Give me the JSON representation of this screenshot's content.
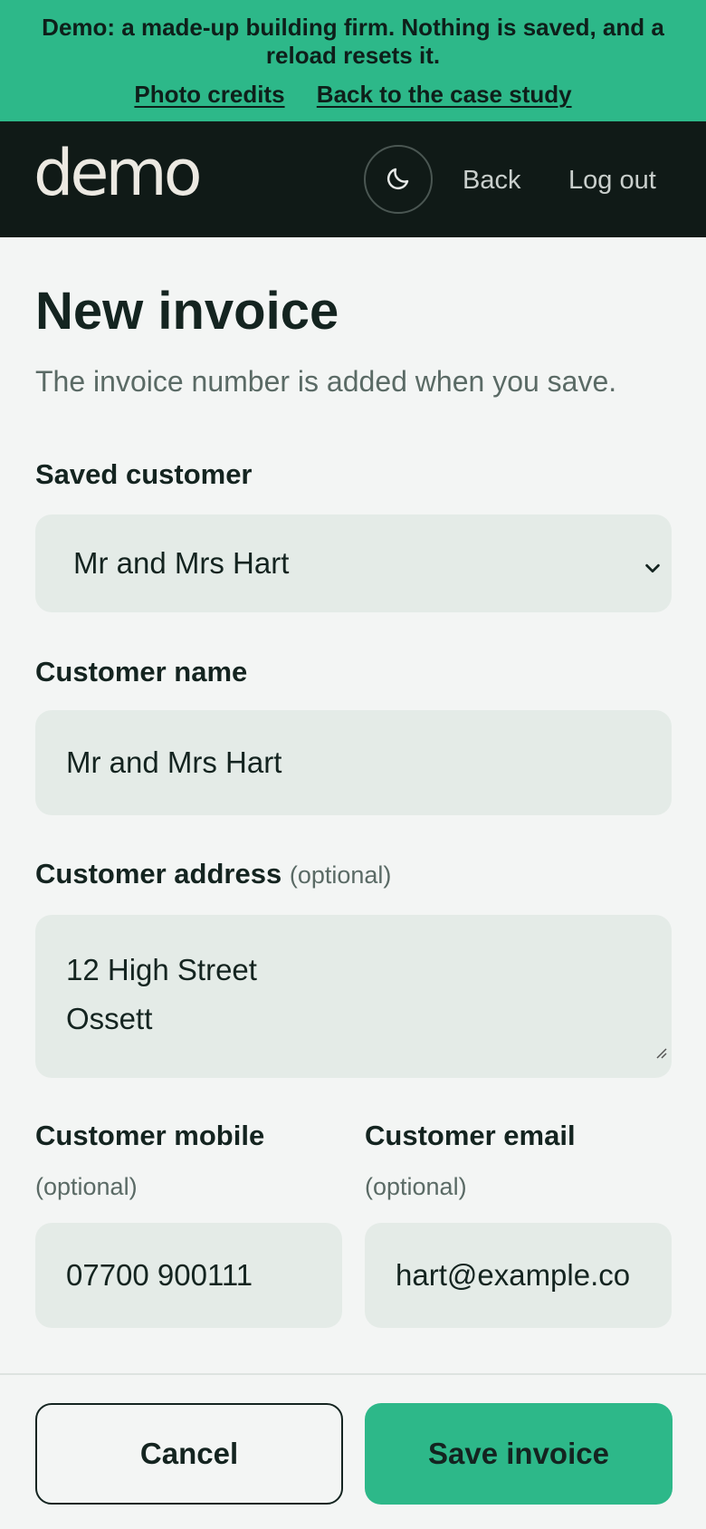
{
  "banner": {
    "message": "Demo: a made-up building firm. Nothing is saved, and a reload resets it.",
    "photo_credits": "Photo credits",
    "back_to_case_study": "Back to the case study"
  },
  "header": {
    "logo": "demo",
    "theme_toggle_icon": "moon-icon",
    "back": "Back",
    "log_out": "Log out"
  },
  "page": {
    "title": "New invoice",
    "subtitle": "The invoice number is added when you save."
  },
  "form": {
    "saved_customer": {
      "label": "Saved customer",
      "value": "Mr and Mrs Hart"
    },
    "customer_name": {
      "label": "Customer name",
      "value": "Mr and Mrs Hart"
    },
    "customer_address": {
      "label": "Customer address",
      "optional": "(optional)",
      "line1": "12 High Street",
      "line2": "Ossett"
    },
    "customer_mobile": {
      "label": "Customer mobile",
      "optional": "(optional)",
      "value": "07700 900111"
    },
    "customer_email": {
      "label": "Customer email",
      "optional": "(optional)",
      "value": "hart@example.co"
    }
  },
  "actions": {
    "cancel": "Cancel",
    "save": "Save invoice"
  },
  "colors": {
    "accent": "#2db889",
    "header_bg": "#101a17",
    "page_bg": "#f3f5f4",
    "field_bg": "#e4ebe7"
  }
}
